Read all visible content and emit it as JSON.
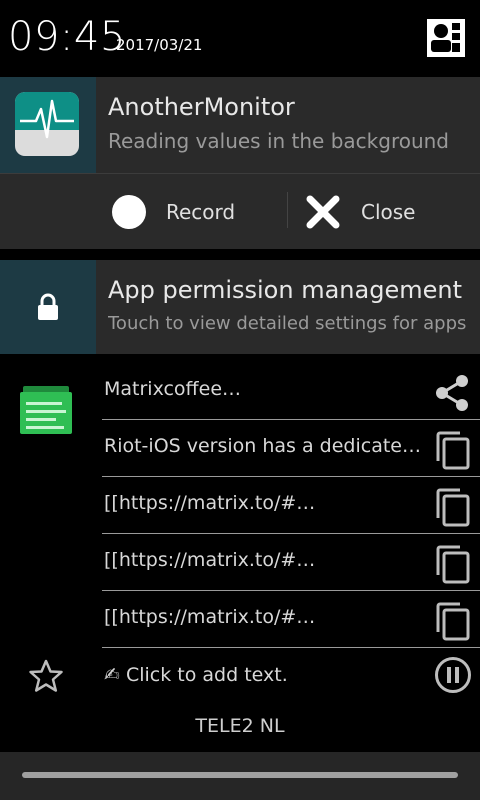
{
  "status_bar": {
    "time": "09:45",
    "date": "2017/03/21",
    "profile_icon": "user-settings-icon"
  },
  "monitor_notification": {
    "app_icon": "heartbeat-icon",
    "title": "AnotherMonitor",
    "subtitle": "Reading values in the background",
    "actions": {
      "record_label": "Record",
      "close_label": "Close"
    },
    "colors": {
      "icon_bg": "#1d3a44",
      "card_bg": "#2a2a2a",
      "icon_teal": "#0e8f86"
    }
  },
  "permission_notification": {
    "icon": "lock-icon",
    "title": "App permission management",
    "subtitle": "Touch to view detailed settings for apps"
  },
  "clipboard": {
    "app_icon": "clipboard-list-icon",
    "items": [
      {
        "text": "Matrixcoffee…",
        "icon": "share-icon"
      },
      {
        "text": "Riot-iOS version has a dedicated support room",
        "icon": "copy-icon"
      },
      {
        "text": "[[https://matrix.to/#…",
        "icon": "copy-icon"
      },
      {
        "text": "[[https://matrix.to/#…",
        "icon": "copy-icon"
      },
      {
        "text": "[[https://matrix.to/#…",
        "icon": "copy-icon"
      }
    ],
    "add_text": "✍ Click to add text.",
    "star_icon": "star-icon",
    "pause_icon": "pause-icon"
  },
  "carrier": "TELE2 NL"
}
